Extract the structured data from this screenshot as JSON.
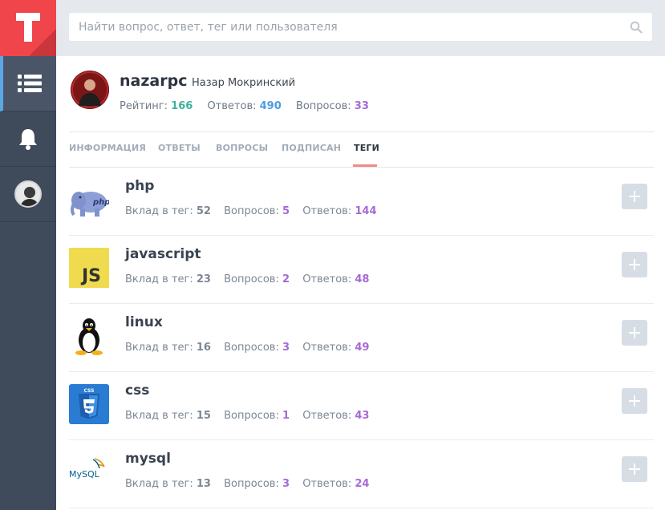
{
  "sidebar": {
    "logo_letter": "T",
    "items": [
      {
        "icon": "list-icon",
        "active": true
      },
      {
        "icon": "bell-icon",
        "active": false
      },
      {
        "icon": "avatar",
        "active": false
      }
    ]
  },
  "search": {
    "placeholder": "Найти вопрос, ответ, тег или пользователя"
  },
  "profile": {
    "username": "nazarpc",
    "fullname": "Назар Мокринский",
    "rating_label": "Рейтинг:",
    "rating_value": "166",
    "answers_label": "Ответов:",
    "answers_value": "490",
    "questions_label": "Вопросов:",
    "questions_value": "33"
  },
  "tabs": [
    {
      "label": "ИНФОРМАЦИЯ"
    },
    {
      "label": "ОТВЕТЫ"
    },
    {
      "label": "ВОПРОСЫ"
    },
    {
      "label": "ПОДПИСАН"
    },
    {
      "label": "ТЕГИ",
      "active": true
    }
  ],
  "tags": [
    {
      "name": "php",
      "icon": "php-elephant-icon",
      "contrib_label": "Вклад в тег:",
      "contrib": "52",
      "q_label": "Вопросов:",
      "q": "5",
      "a_label": "Ответов:",
      "a": "144"
    },
    {
      "name": "javascript",
      "icon": "js-icon",
      "icon_text": "JS",
      "contrib_label": "Вклад в тег:",
      "contrib": "23",
      "q_label": "Вопросов:",
      "q": "2",
      "a_label": "Ответов:",
      "a": "48"
    },
    {
      "name": "linux",
      "icon": "tux-penguin-icon",
      "contrib_label": "Вклад в тег:",
      "contrib": "16",
      "q_label": "Вопросов:",
      "q": "3",
      "a_label": "Ответов:",
      "a": "49"
    },
    {
      "name": "css",
      "icon": "css3-shield-icon",
      "icon_text": "CSS",
      "contrib_label": "Вклад в тег:",
      "contrib": "15",
      "q_label": "Вопросов:",
      "q": "1",
      "a_label": "Ответов:",
      "a": "43"
    },
    {
      "name": "mysql",
      "icon": "mysql-logo-icon",
      "icon_text": "MySQL",
      "contrib_label": "Вклад в тег:",
      "contrib": "13",
      "q_label": "Вопросов:",
      "q": "3",
      "a_label": "Ответов:",
      "a": "24"
    }
  ],
  "colors": {
    "brand": "#f0464b",
    "sidebar": "#3f4a5a",
    "rating": "#3bb39b",
    "answers": "#4a9de0",
    "questions": "#a56ad6",
    "tab_underline": "#f28b86"
  }
}
